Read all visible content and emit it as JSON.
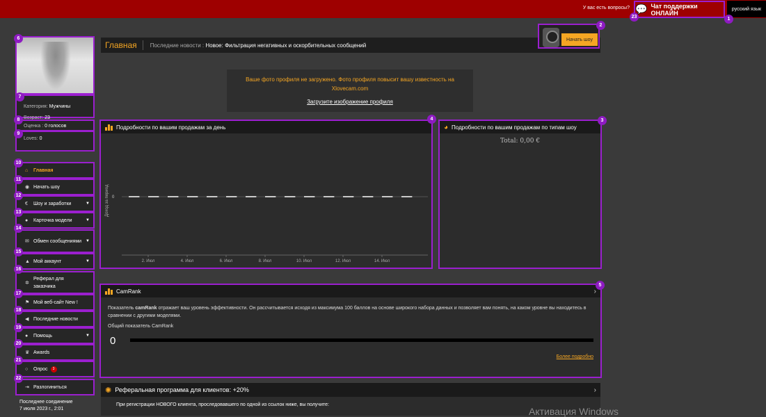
{
  "topbar": {
    "question": "У вас есть вопросы?",
    "chat_label": "Чат поддержки ОНЛАЙН",
    "language": "русский язык"
  },
  "badges": [
    "1",
    "2",
    "3",
    "4",
    "5",
    "6",
    "7",
    "8",
    "9",
    "10",
    "11",
    "12",
    "13",
    "14",
    "15",
    "16",
    "17",
    "18",
    "19",
    "20",
    "21",
    "22",
    "23"
  ],
  "header": {
    "title": "Главная",
    "news_prefix": "Последние новости :",
    "news_text": "Новое: Фильтрация негативных и оскорбительных сообщений"
  },
  "start_show": {
    "label": "Начать шоу"
  },
  "notice": {
    "warning": "Ваше фото профиля не загружено. Фото профиля повысит вашу известность на Xlovecam.com",
    "upload_link": "Загрузите изображение профиля"
  },
  "profile": {
    "category_label": "Категория:",
    "category_value": "Мужчины",
    "age_label": "Возраст:",
    "age_value": "23",
    "rating_label": "Оценка :",
    "rating_value": "0 голосов",
    "loves_label": "Loves:",
    "loves_value": "0"
  },
  "menu": [
    {
      "label": "Главная",
      "icon": "home-icon",
      "glyph": "⌂"
    },
    {
      "label": "Начать шоу",
      "icon": "webcam-icon",
      "glyph": "◉"
    },
    {
      "label": "Шоу и заработки",
      "icon": "euro-icon",
      "glyph": "€"
    },
    {
      "label": "Карточка модели",
      "icon": "user-card-icon",
      "glyph": "●"
    },
    {
      "label": "Обмен сообщениями",
      "icon": "envelope-icon",
      "glyph": "✉"
    },
    {
      "label": "Мой аккаунт",
      "icon": "user-icon",
      "glyph": "▲"
    },
    {
      "label": "Реферал для заказчика",
      "icon": "sun-icon",
      "glyph": "✲"
    },
    {
      "label": "Мой веб-сайт New !",
      "icon": "flag-icon",
      "glyph": "⚑"
    },
    {
      "label": "Последние новости",
      "icon": "megaphone-icon",
      "glyph": "◀"
    },
    {
      "label": "Помощь",
      "icon": "help-icon",
      "glyph": "●"
    },
    {
      "label": "Awards",
      "icon": "trophy-icon",
      "glyph": "♛"
    },
    {
      "label": "Опрос",
      "icon": "chat-bubble-icon",
      "glyph": "○",
      "count": "3"
    },
    {
      "label": "Разлогиниться",
      "icon": "logout-icon",
      "glyph": "⇥"
    }
  ],
  "last_connection": {
    "label": "Последнее соединение",
    "value": "7 июля 2023 г., 2:01"
  },
  "sales_day": {
    "title": "Подробности по вашим продажам за день",
    "ylabel": "Доход за период"
  },
  "sales_type": {
    "title": "Подробности по вашим продажам по типам шоу",
    "total": "Total: 0,00 €"
  },
  "chart_data": {
    "type": "line",
    "title": "Подробности по вашим продажам за день",
    "ylabel": "Доход за период",
    "categories": [
      "2. Июл",
      "4. Июл",
      "6. Июл",
      "8. Июл",
      "10. Июл",
      "12. Июл",
      "14. Июл"
    ],
    "x_ticks_day": [
      2,
      4,
      6,
      8,
      10,
      12,
      14
    ],
    "y_tick": "0",
    "series": [
      {
        "values": [
          0,
          0,
          0,
          0,
          0,
          0,
          0,
          0,
          0,
          0,
          0,
          0,
          0,
          0,
          0,
          0
        ]
      }
    ]
  },
  "camrank": {
    "title": "CamRank",
    "text_prefix": "Показатель ",
    "text_bold": "camRank",
    "text_rest": " отражает ваш уровень эффективности. Он рассчитывается исходя из максимума 100 баллов на основе широкого набора данных и позволяет вам понять, на каком уровне вы находитесь в сравнении с другими моделями.",
    "score_label": "Общий показатель CamRank",
    "score": "0",
    "more": "Более подробно"
  },
  "referral": {
    "title": "Реферальная программа для клиентов: +20%",
    "text": "При регистрации НОВОГО клиента, проследовавшего по одной из ссылок ниже, вы получите:"
  },
  "watermark": "Активация Windows",
  "colors": {
    "accent": "#f5a623",
    "topbar": "#9e0000",
    "highlight": "#9b1fcf"
  }
}
